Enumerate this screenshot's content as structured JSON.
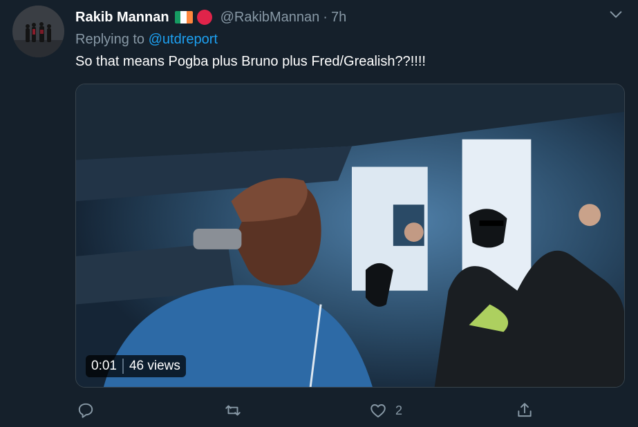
{
  "tweet": {
    "author_name": "Rakib Mannan",
    "handle": "@RakibMannan",
    "separator": "·",
    "time": "7h",
    "replying_prefix": "Replying to",
    "replying_to": "@utdreport",
    "text": "So that means Pogba plus Bruno plus Fred/Grealish??!!!!"
  },
  "emoji": {
    "flag": "ireland-flag",
    "circle": "red-circle",
    "flag_colors": [
      "#169b62",
      "#ffffff",
      "#ff883e"
    ],
    "circle_color": "#e0244a"
  },
  "video": {
    "duration": "0:01",
    "views": "46 views"
  },
  "actions": {
    "reply_icon": "reply-icon",
    "retweet_icon": "retweet-icon",
    "like_icon": "heart-icon",
    "like_count": "2",
    "share_icon": "share-icon"
  },
  "colors": {
    "background": "#15202b",
    "secondary_text": "#8899a6",
    "link": "#1da1f2"
  }
}
